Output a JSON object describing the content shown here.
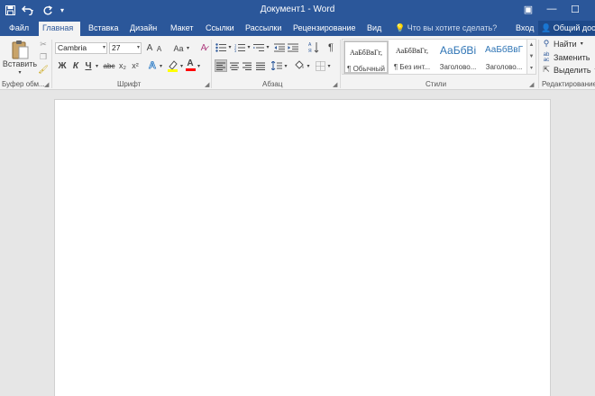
{
  "window": {
    "title": "Документ1 - Word",
    "controls": {
      "ribbon_display": "▣",
      "minimize": "—",
      "maximize": "☐"
    }
  },
  "quick_access": {
    "save_icon": "save-icon",
    "undo_icon": "undo-icon",
    "redo_icon": "redo-icon",
    "customize_icon": "customize-icon"
  },
  "tabs": [
    {
      "label": "Файл",
      "active": false
    },
    {
      "label": "Главная",
      "active": true
    },
    {
      "label": "Вставка",
      "active": false
    },
    {
      "label": "Дизайн",
      "active": false
    },
    {
      "label": "Макет",
      "active": false
    },
    {
      "label": "Ссылки",
      "active": false
    },
    {
      "label": "Рассылки",
      "active": false
    },
    {
      "label": "Рецензирование",
      "active": false
    },
    {
      "label": "Вид",
      "active": false
    }
  ],
  "tell_me": {
    "placeholder": "Что вы хотите сделать?"
  },
  "account": {
    "signin": "Вход",
    "share": "Общий доступ"
  },
  "ribbon": {
    "clipboard": {
      "label": "Буфер обм...",
      "paste": "Вставить"
    },
    "font": {
      "label": "Шрифт",
      "font_name": "Cambria",
      "font_size": "27",
      "bold": "Ж",
      "italic": "К",
      "underline": "Ч",
      "strike": "abc",
      "subscript": "x₂",
      "superscript": "x²",
      "grow": "A",
      "shrink": "A",
      "case": "Aa",
      "text_effects": "A",
      "font_color": "A"
    },
    "paragraph": {
      "label": "Абзац",
      "show_marks": "¶"
    },
    "styles": {
      "label": "Стили",
      "items": [
        {
          "sample": "АаБбВвГг,",
          "name": "¶ Обычный",
          "selected": true
        },
        {
          "sample": "АаБбВвГг,",
          "name": "¶ Без инт...",
          "selected": false
        },
        {
          "sample": "АаБбВі",
          "name": "Заголово...",
          "selected": false
        },
        {
          "sample": "АаБбВвГ",
          "name": "Заголово...",
          "selected": false
        }
      ]
    },
    "editing": {
      "label": "Редактирование",
      "find": "Найти",
      "replace": "Заменить",
      "select": "Выделить"
    }
  },
  "colors": {
    "accent": "#2b579a",
    "highlight": "#ffff00",
    "font_color": "#ff0000",
    "heading": "#2e74b5"
  }
}
